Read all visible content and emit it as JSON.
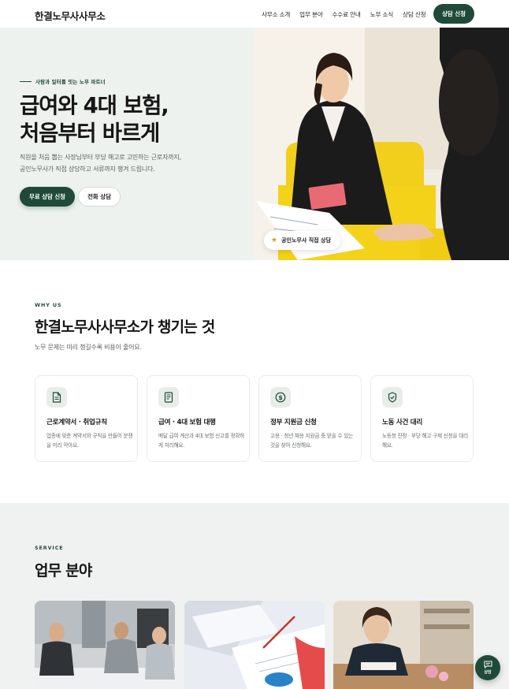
{
  "header": {
    "logo": "한결노무사사무소",
    "nav": [
      "사무소 소개",
      "업무 분야",
      "수수료 안내",
      "노무 소식",
      "상담 신청"
    ],
    "cta": "상담 신청"
  },
  "hero": {
    "eyebrow": "사람과 일터를 잇는 노무 파트너",
    "title_line1": "급여와 4대 보험,",
    "title_line2": "처음부터 바르게",
    "desc_line1": "직원을 처음 뽑는 사장님부터 부당 해고로 고민하는 근로자까지,",
    "desc_line2": "공인노무사가 직접 상담하고 서류까지 챙겨 드립니다.",
    "primary_button": "무료 상담 신청",
    "secondary_button": "전화 상담",
    "badge": "공인노무사 직접 상담"
  },
  "why": {
    "label": "WHY US",
    "title": "한결노무사사무소가 챙기는 것",
    "subtitle": "노무 문제는 미리 챙길수록 비용이 줄어요.",
    "cards": [
      {
        "icon": "document-icon",
        "title": "근로계약서 · 취업규칙",
        "desc": "업종에 맞춘 계약서와 규칙을 만들어 분쟁을 미리 막아요."
      },
      {
        "icon": "receipt-icon",
        "title": "급여 · 4대 보험 대행",
        "desc": "매달 급여 계산과 4대 보험 신고를 정확하게 처리해요."
      },
      {
        "icon": "dollar-circle-icon",
        "title": "정부 지원금 신청",
        "desc": "고용 · 청년 채용 지원금 중 받을 수 있는 것을 찾아 신청해요."
      },
      {
        "icon": "shield-check-icon",
        "title": "노동 사건 대리",
        "desc": "노동청 진정 · 부당 해고 구제 신청을 대리해요."
      }
    ]
  },
  "service": {
    "label": "SERVICE",
    "title": "업무 분야"
  },
  "fab": {
    "label": "상담"
  },
  "colors": {
    "brand": "#1f4a3a",
    "hero_bg": "#eef2ef",
    "section_bg": "#eff2f0",
    "accent_star": "#c9a227"
  }
}
